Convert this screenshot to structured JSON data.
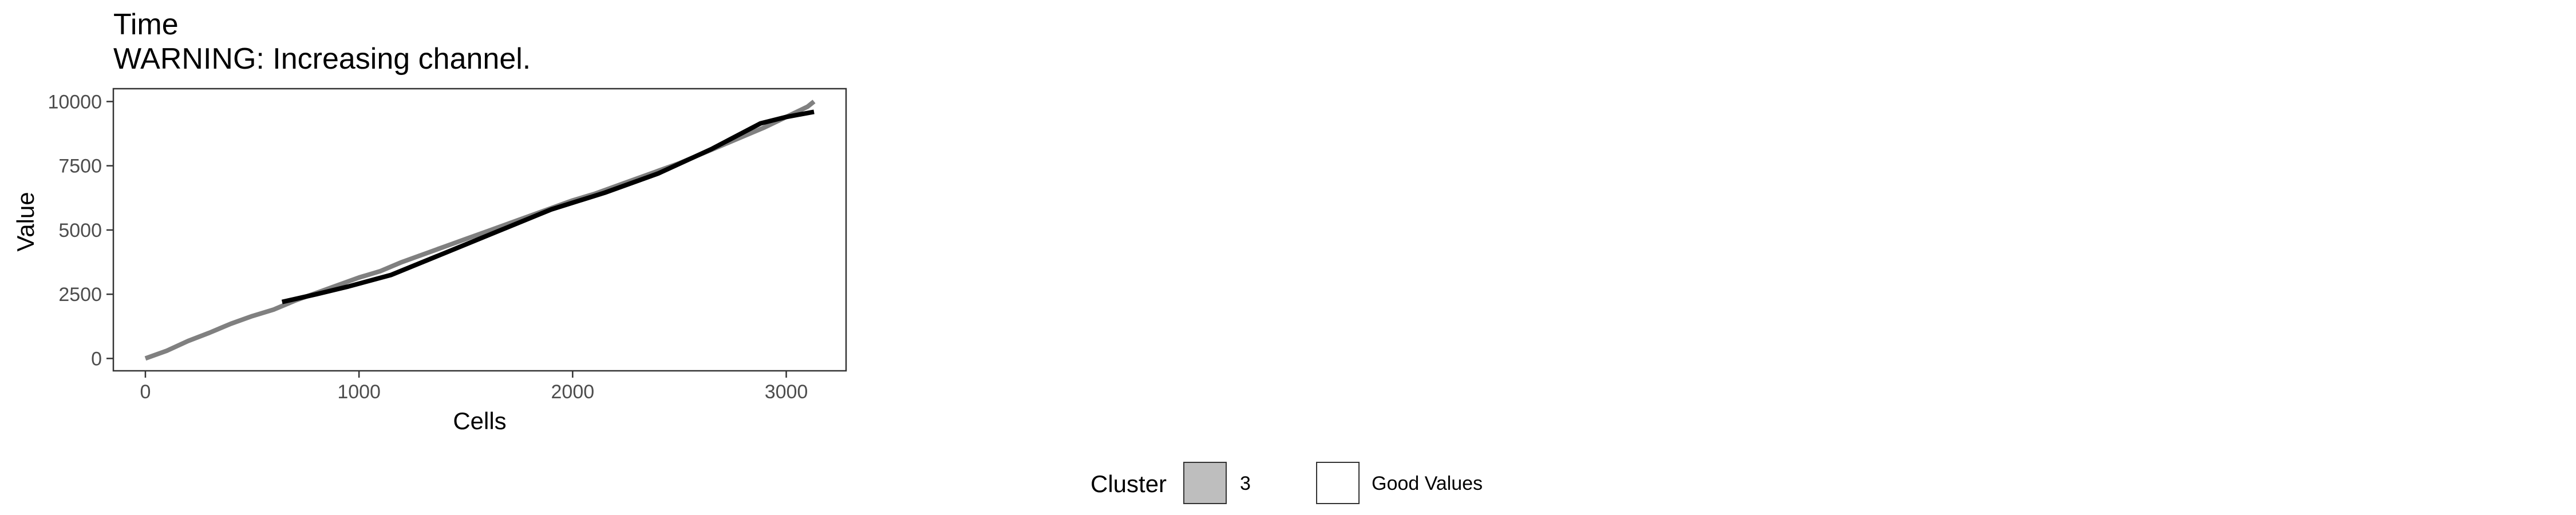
{
  "chart_data": {
    "type": "line",
    "title": "Time",
    "subtitle": "WARNING: Increasing channel.",
    "xlabel": "Cells",
    "ylabel": "Value",
    "xlim": [
      -150,
      3280
    ],
    "ylim": [
      -480,
      10500
    ],
    "x_ticks": [
      0,
      1000,
      2000,
      3000
    ],
    "y_ticks": [
      0,
      2500,
      5000,
      7500,
      10000
    ],
    "x_tick_labels": [
      "0",
      "1000",
      "2000",
      "3000"
    ],
    "y_tick_labels": [
      "0",
      "2500",
      "5000",
      "7500",
      "10000"
    ],
    "grid": false,
    "legend_position": "bottom",
    "colors": {
      "cluster_line": "#808080",
      "good_values_line": "#000000",
      "cluster_fill": "#bebebe",
      "good_values_fill": "#ffffff",
      "panel_border": "#333333",
      "tick_text": "#4d4d4d"
    },
    "series": [
      {
        "legend_key": "cluster",
        "x": [
          0,
          100,
          200,
          300,
          400,
          500,
          600,
          700,
          800,
          900,
          1000,
          1100,
          1200,
          1300,
          1400,
          1500,
          1600,
          1700,
          1800,
          1900,
          2000,
          2100,
          2200,
          2300,
          2400,
          2500,
          2600,
          2700,
          2800,
          2900,
          3000,
          3100,
          3130
        ],
        "y": [
          0,
          300,
          680,
          1000,
          1350,
          1650,
          1900,
          2250,
          2550,
          2850,
          3150,
          3400,
          3750,
          4050,
          4350,
          4650,
          4950,
          5250,
          5550,
          5850,
          6150,
          6400,
          6700,
          7000,
          7300,
          7600,
          7950,
          8300,
          8650,
          9000,
          9400,
          9800,
          10000
        ]
      },
      {
        "legend_key": "good",
        "x": [
          640,
          800,
          950,
          1150,
          1400,
          1650,
          1900,
          2150,
          2400,
          2650,
          2880,
          3000,
          3130
        ],
        "y": [
          2200,
          2500,
          2800,
          3250,
          4100,
          4950,
          5800,
          6450,
          7200,
          8150,
          9150,
          9400,
          9600
        ]
      }
    ]
  },
  "legend": {
    "title": "Cluster",
    "items": [
      {
        "key": "cluster",
        "label": "3"
      },
      {
        "key": "good",
        "label": "Good Values"
      }
    ]
  }
}
